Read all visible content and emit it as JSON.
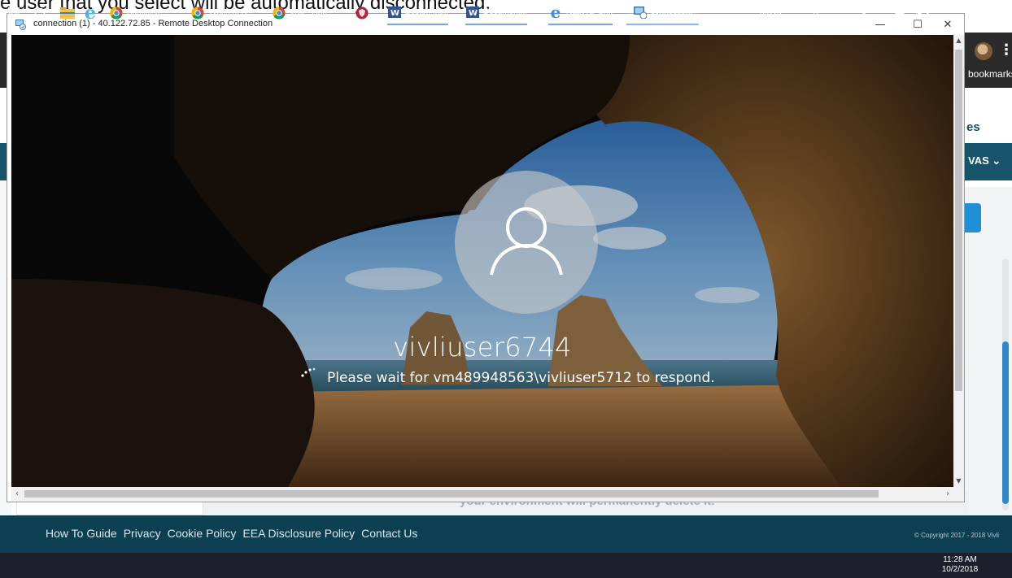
{
  "background_doc": {
    "partial_sentence": "e user that you select will be automatically disconnected."
  },
  "browser_bg": {
    "bookmarks_label": "bookmarks",
    "heading_fragment": "es",
    "account_menu": "VAS",
    "hidden_text": "your environment will permanently delete it.",
    "footer_links": [
      "How To Guide",
      "Privacy",
      "Cookie Policy",
      "EEA Disclosure Policy",
      "Contact Us"
    ],
    "copyright": "© Copyright 2017 - 2018 Vivli"
  },
  "rdp_window": {
    "title": "connection (1) - 40.122.72.85 - Remote Desktop Connection",
    "minimize_glyph": "—",
    "maximize_glyph": "☐",
    "close_glyph": "✕",
    "lock_screen": {
      "username": "vivliuser6744",
      "message": "Please wait for vm489948563\\vivliuser5712 to respond."
    }
  },
  "taskbar": {
    "items": [
      {
        "label": "Administr...",
        "icon": "chrome-icon"
      },
      {
        "label": "Types of D...",
        "icon": "chrome-icon"
      },
      {
        "label": "Vivli - Goo...",
        "icon": "chrome-icon"
      },
      {
        "label": "",
        "icon": "shield-app-icon"
      },
      {
        "label": "Boston Int...",
        "icon": "word-icon"
      },
      {
        "label": "Document...",
        "icon": "word-icon"
      },
      {
        "label": "Nauvya_Sr...",
        "icon": "edge-icon"
      },
      {
        "label": "connectio...",
        "icon": "remote-desktop-icon"
      }
    ],
    "toolbar_label": "navya",
    "overflow_glyph": "»",
    "clock_time": "11:28 AM",
    "clock_date": "10/2/2018"
  },
  "colors": {
    "footer_bg": "#0d3f52",
    "navbar_bg": "#17546b",
    "taskbar_bg": "#1d1f2c"
  }
}
